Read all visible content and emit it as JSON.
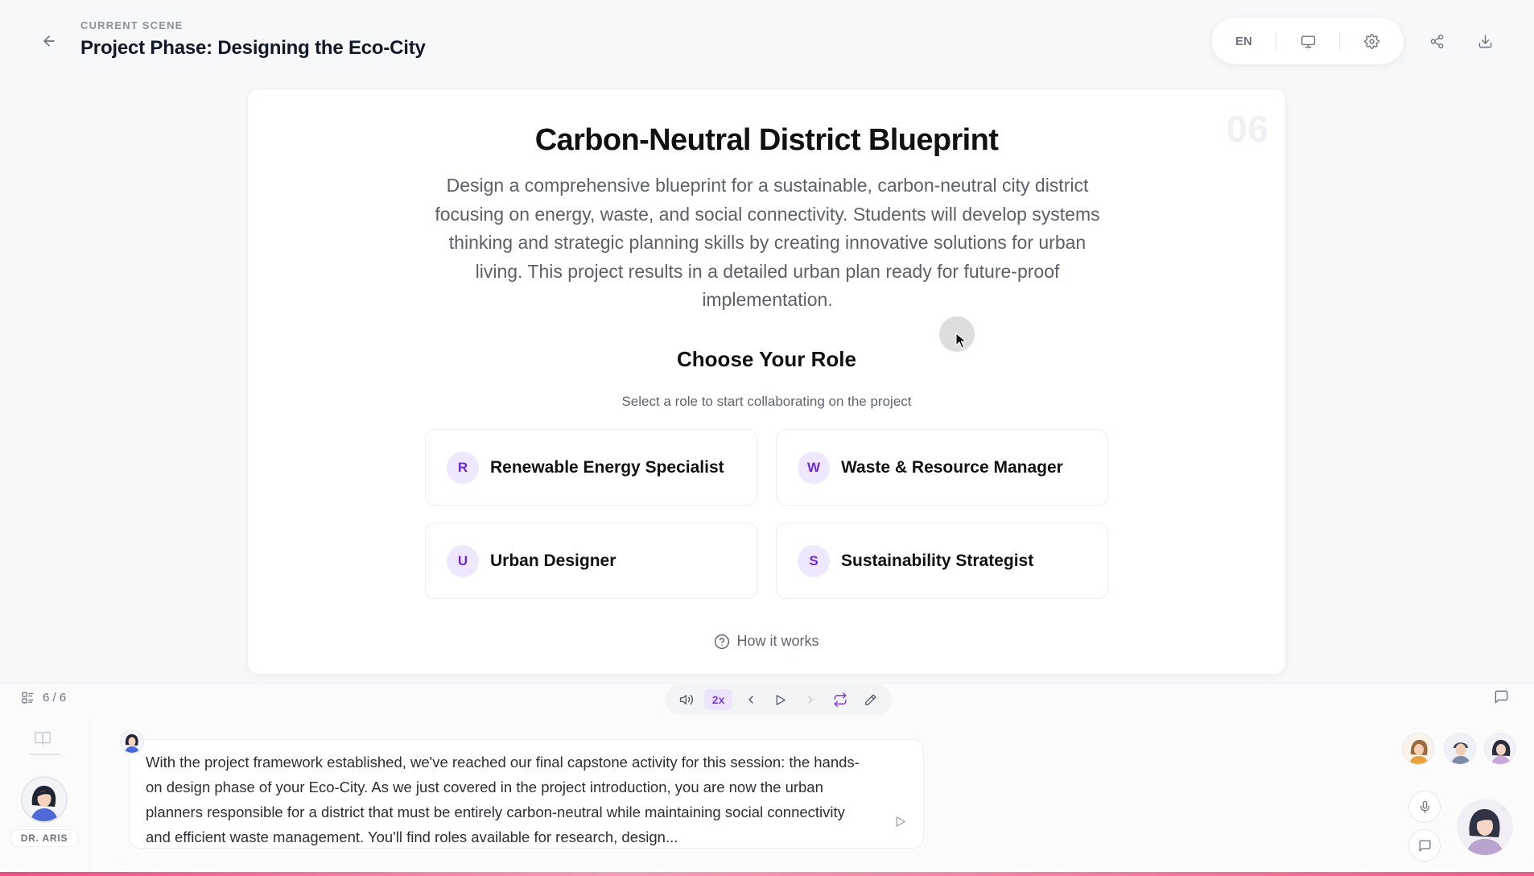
{
  "header": {
    "kicker": "CURRENT SCENE",
    "title": "Project Phase: Designing the Eco-City",
    "language": "EN"
  },
  "slide": {
    "number": "06",
    "title": "Carbon-Neutral District Blueprint",
    "description": "Design a comprehensive blueprint for a sustainable, carbon-neutral city district focusing on energy, waste, and social connectivity. Students will develop systems thinking and strategic planning skills by creating innovative solutions for urban living. This project results in a detailed urban plan ready for future-proof implementation.",
    "role_heading": "Choose Your Role",
    "role_subheading": "Select a role to start collaborating on the project",
    "roles": [
      {
        "initial": "R",
        "label": "Renewable Energy Specialist"
      },
      {
        "initial": "W",
        "label": "Waste & Resource Manager"
      },
      {
        "initial": "U",
        "label": "Urban Designer"
      },
      {
        "initial": "S",
        "label": "Sustainability Strategist"
      }
    ],
    "how_it_works": "How it works"
  },
  "playback": {
    "scene_position": "6 / 6",
    "speed": "2x"
  },
  "teacher": {
    "name": "DR. ARIS"
  },
  "transcript": {
    "text": "With the project framework established, we've reached our final capstone activity for this session: the hands-on design phase of your Eco-City. As we just covered in the project introduction, you are now the urban planners responsible for a district that must be entirely carbon-neutral while maintaining social connectivity and efficient waste management. You'll find roles available for research, design..."
  },
  "colors": {
    "accent": "#7c3aed",
    "accent_light": "#efe7fd",
    "bottom_bar": "#ef4d86"
  },
  "icons": [
    "back-arrow-icon",
    "monitor-icon",
    "gear-icon",
    "share-icon",
    "download-icon",
    "help-circle-icon",
    "list-icon",
    "volume-icon",
    "chevron-left-icon",
    "play-icon",
    "chevron-right-icon",
    "repeat-icon",
    "pen-icon",
    "chat-icon",
    "book-icon",
    "send-icon",
    "mic-icon"
  ]
}
